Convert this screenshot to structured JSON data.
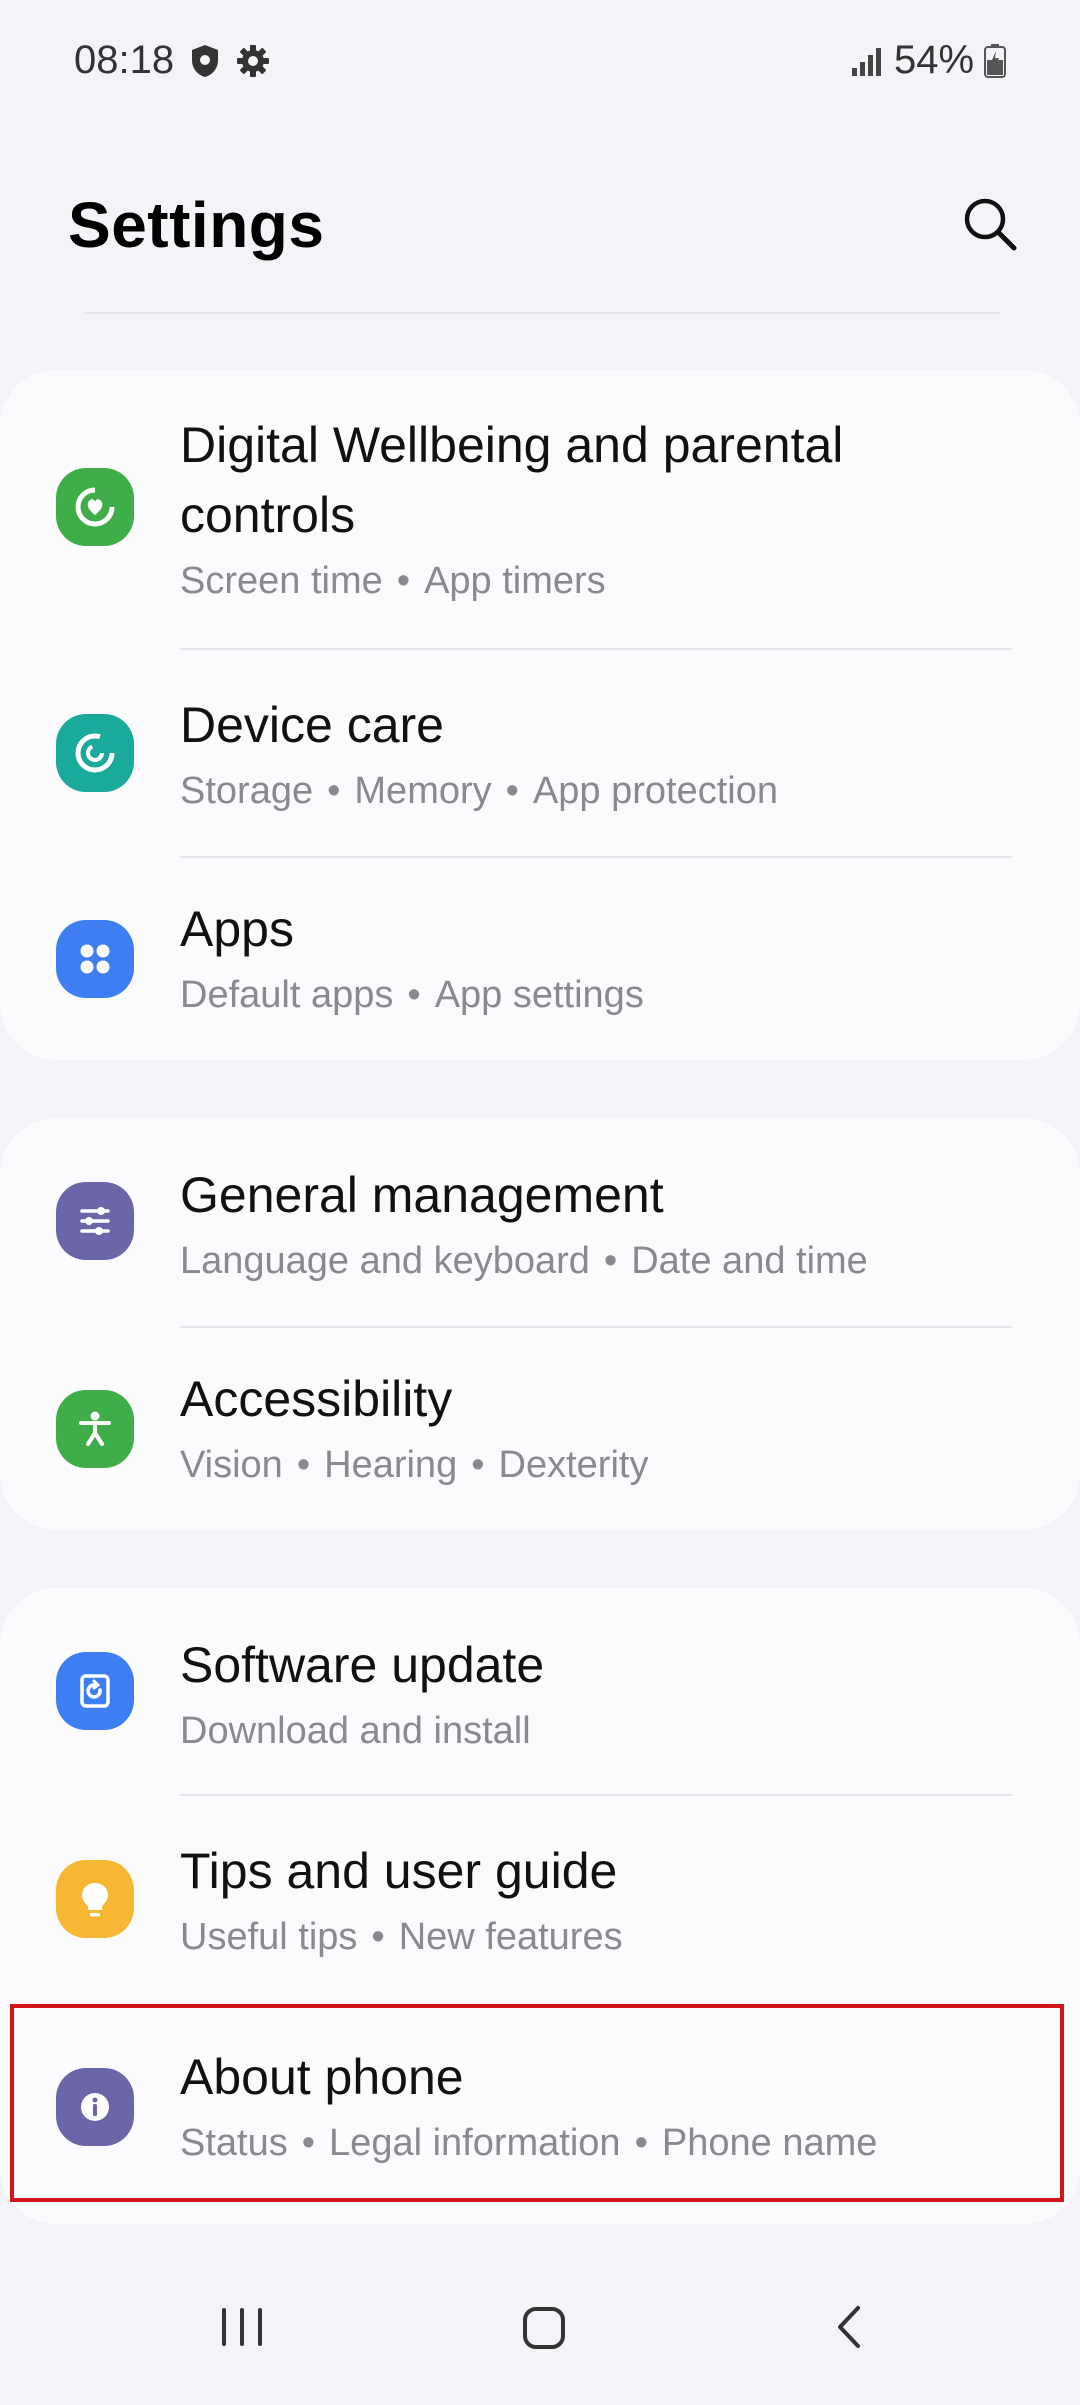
{
  "status_bar": {
    "time": "08:18",
    "battery_percent": "54%",
    "icons": [
      "shield-icon",
      "gear-icon",
      "signal-icon",
      "battery-icon"
    ]
  },
  "header": {
    "title": "Settings",
    "search_icon": "search-icon"
  },
  "groups": [
    {
      "items": [
        {
          "title_line1": "Digital Wellbeing and parental",
          "title_line2": "controls",
          "sub": [
            "Screen time",
            "App timers"
          ],
          "icon": "wellbeing-icon",
          "color": "#3fae49"
        },
        {
          "title": "Device care",
          "sub": [
            "Storage",
            "Memory",
            "App protection"
          ],
          "icon": "device-care-icon",
          "color": "#1aaa9b"
        },
        {
          "title": "Apps",
          "sub": [
            "Default apps",
            "App settings"
          ],
          "icon": "apps-icon",
          "color": "#3d7ff2"
        }
      ]
    },
    {
      "items": [
        {
          "title": "General management",
          "sub": [
            "Language and keyboard",
            "Date and time"
          ],
          "icon": "sliders-icon",
          "color": "#6b66a8"
        },
        {
          "title": "Accessibility",
          "sub": [
            "Vision",
            "Hearing",
            "Dexterity"
          ],
          "icon": "accessibility-icon",
          "color": "#3fae49"
        }
      ]
    },
    {
      "items": [
        {
          "title": "Software update",
          "sub": [
            "Download and install"
          ],
          "icon": "software-update-icon",
          "color": "#3d7ff2"
        },
        {
          "title": "Tips and user guide",
          "sub": [
            "Useful tips",
            "New features"
          ],
          "icon": "lightbulb-icon",
          "color": "#f7b733"
        },
        {
          "title": "About phone",
          "sub": [
            "Status",
            "Legal information",
            "Phone name"
          ],
          "icon": "info-icon",
          "color": "#6b66a8"
        }
      ]
    }
  ],
  "nav_bar": [
    "recents-icon",
    "home-icon",
    "back-icon"
  ],
  "accent": {
    "highlight_border": "#d2151b"
  }
}
